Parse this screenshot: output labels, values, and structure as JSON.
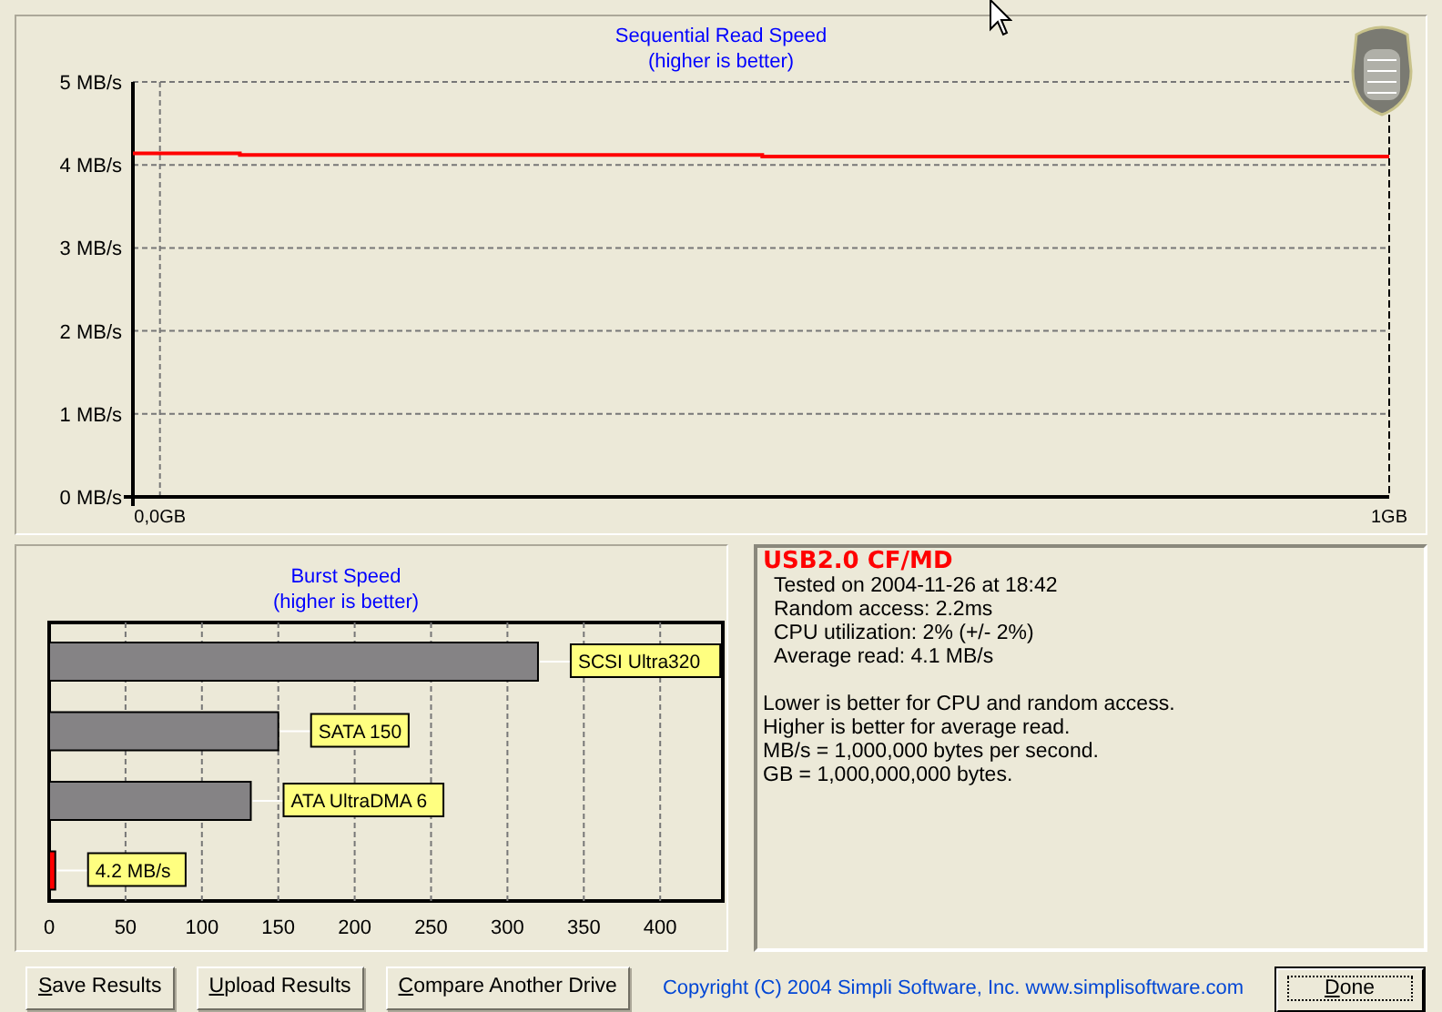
{
  "read_chart": {
    "chart_data": {
      "type": "line",
      "title": "Sequential Read Speed\n(higher is better)",
      "x": [
        -0.022,
        0.065,
        0.065,
        0.49,
        0.49,
        1
      ],
      "series": [
        {
          "color": "#ff0000",
          "values": [
            4.14,
            4.14,
            4.12,
            4.12,
            4.1,
            4.1
          ]
        }
      ],
      "xlim": [
        -0.022,
        1
      ],
      "ylim": [
        0,
        5
      ],
      "grid": true,
      "xticks": [
        {
          "value": 0,
          "label": "0,0GB"
        },
        {
          "value": 1,
          "label": "1GB"
        }
      ],
      "yticks": [
        {
          "value": 0,
          "label": "0 MB/s"
        },
        {
          "value": 1,
          "label": "1 MB/s"
        },
        {
          "value": 2,
          "label": "2 MB/s"
        },
        {
          "value": 3,
          "label": "3 MB/s"
        },
        {
          "value": 4,
          "label": "4 MB/s"
        },
        {
          "value": 5,
          "label": "5 MB/s"
        }
      ]
    }
  },
  "burst_chart": {
    "chart_data": {
      "type": "bar",
      "orientation": "horizontal",
      "grid": true,
      "title": "Burst Speed\n(higher is better)",
      "categories": [
        "SCSI Ultra320",
        "SATA 150",
        "ATA UltraDMA 6",
        "4.2 MB/s"
      ],
      "series": [
        {
          "color": "#858385",
          "values": [
            320,
            150,
            132,
            null
          ]
        },
        {
          "color": "#ff0000",
          "values": [
            null,
            null,
            null,
            4
          ]
        }
      ],
      "xlim": [
        0,
        441
      ],
      "xticks": [
        0,
        50,
        100,
        150,
        200,
        250,
        300,
        350,
        400
      ]
    }
  },
  "info": {
    "drive": "USB2.0 CF/MD",
    "details": [
      "Tested on 2004-11-26 at 18:42",
      "Random access: 2.2ms",
      "CPU utilization: 2% (+/- 2%)",
      "Average read: 4.1 MB/s"
    ],
    "notes": [
      "Lower is better for CPU and random access.",
      "Higher is better for average read.",
      "MB/s = 1,000,000 bytes per second.",
      "GB = 1,000,000,000 bytes."
    ]
  },
  "buttons": [
    {
      "label": "Save Results",
      "focused": false
    },
    {
      "label": "Upload Results",
      "focused": false
    },
    {
      "label": "Compare Another Drive",
      "focused": false
    }
  ],
  "copyright": "Copyright (C) 2004 Simpli Software, Inc. www.simplisoftware.com",
  "done_button": {
    "label": "Done",
    "focused": true
  }
}
